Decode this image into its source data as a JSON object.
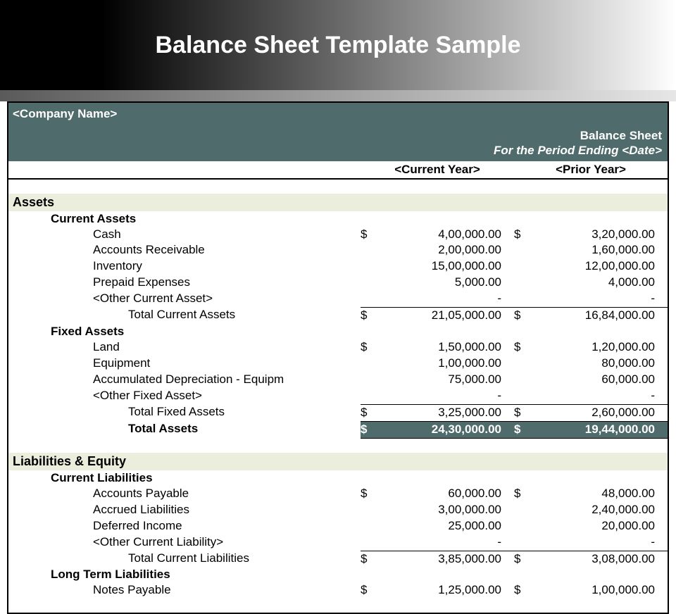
{
  "banner_title": "Balance Sheet Template Sample",
  "company_name": "<Company Name>",
  "doc_title": "Balance Sheet",
  "period_label": "For the Period Ending <Date>",
  "col_current": "<Current Year>",
  "col_prior": "<Prior Year>",
  "currency_symbol": "$",
  "sections": {
    "assets": {
      "title": "Assets",
      "groups": [
        {
          "name": "Current Assets",
          "items": [
            {
              "label": "Cash",
              "current": "4,00,000.00",
              "prior": "3,20,000.00",
              "show_currency": true
            },
            {
              "label": "Accounts Receivable",
              "current": "2,00,000.00",
              "prior": "1,60,000.00"
            },
            {
              "label": "Inventory",
              "current": "15,00,000.00",
              "prior": "12,00,000.00"
            },
            {
              "label": "Prepaid Expenses",
              "current": "5,000.00",
              "prior": "4,000.00"
            },
            {
              "label": "<Other Current Asset>",
              "current": "-",
              "prior": "-"
            }
          ],
          "total": {
            "label": "Total Current Assets",
            "current": "21,05,000.00",
            "prior": "16,84,000.00"
          }
        },
        {
          "name": "Fixed Assets",
          "items": [
            {
              "label": "Land",
              "current": "1,50,000.00",
              "prior": "1,20,000.00",
              "show_currency": true
            },
            {
              "label": "Equipment",
              "current": "1,00,000.00",
              "prior": "80,000.00"
            },
            {
              "label": "Accumulated Depreciation - Equipm",
              "current": "75,000.00",
              "prior": "60,000.00"
            },
            {
              "label": "<Other Fixed Asset>",
              "current": "-",
              "prior": "-"
            }
          ],
          "total": {
            "label": "Total Fixed Assets",
            "current": "3,25,000.00",
            "prior": "2,60,000.00"
          }
        }
      ],
      "grand_total": {
        "label": "Total Assets",
        "current": "24,30,000.00",
        "prior": "19,44,000.00"
      }
    },
    "liab_equity": {
      "title": "Liabilities & Equity",
      "groups": [
        {
          "name": "Current Liabilities",
          "items": [
            {
              "label": "Accounts Payable",
              "current": "60,000.00",
              "prior": "48,000.00",
              "show_currency": true
            },
            {
              "label": "Accrued Liabilities",
              "current": "3,00,000.00",
              "prior": "2,40,000.00"
            },
            {
              "label": "Deferred Income",
              "current": "25,000.00",
              "prior": "20,000.00"
            },
            {
              "label": "<Other Current Liability>",
              "current": "-",
              "prior": "-"
            }
          ],
          "total": {
            "label": "Total Current Liabilities",
            "current": "3,85,000.00",
            "prior": "3,08,000.00"
          }
        },
        {
          "name": "Long Term Liabilities",
          "items": [
            {
              "label": "Notes Payable",
              "current": "1,25,000.00",
              "prior": "1,00,000.00",
              "show_currency": true
            }
          ]
        }
      ]
    }
  }
}
